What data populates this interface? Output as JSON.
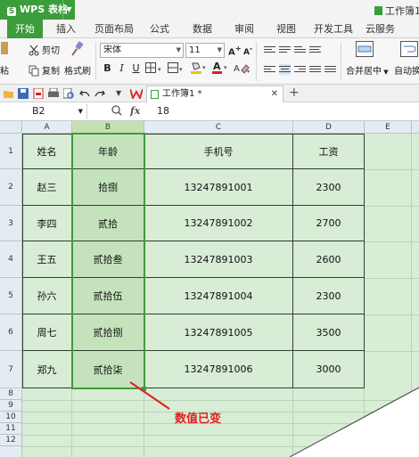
{
  "app": {
    "name": "WPS 表格",
    "document_title": "工作簿1",
    "doc_tab": "工作簿1 *"
  },
  "menu": [
    "开始",
    "插入",
    "页面布局",
    "公式",
    "数据",
    "审阅",
    "视图",
    "开发工具",
    "云服务"
  ],
  "ribbon": {
    "paste_fragment": "粘",
    "cut": "剪切",
    "copy": "复制",
    "format_painter": "格式刷",
    "font_name": "宋体",
    "font_size": "11",
    "bold": "B",
    "italic": "I",
    "underline": "U",
    "merge_center": "合并居中",
    "auto_fragment": "自动换"
  },
  "formula_bar": {
    "name_box": "B2",
    "fx": "fx",
    "value": "18"
  },
  "columns": [
    "A",
    "B",
    "C",
    "D",
    "E"
  ],
  "rows": [
    "1",
    "2",
    "3",
    "4",
    "5",
    "6",
    "7",
    "8",
    "9",
    "10",
    "11",
    "12"
  ],
  "table": {
    "headers": [
      "姓名",
      "年龄",
      "手机号",
      "工资"
    ],
    "rows": [
      [
        "赵三",
        "拾捌",
        "13247891001",
        "2300"
      ],
      [
        "李四",
        "贰拾",
        "13247891002",
        "2700"
      ],
      [
        "王五",
        "贰拾叁",
        "13247891003",
        "2600"
      ],
      [
        "孙六",
        "贰拾伍",
        "13247891004",
        "2300"
      ],
      [
        "周七",
        "贰拾捌",
        "13247891005",
        "3500"
      ],
      [
        "郑九",
        "贰拾柒",
        "13247891006",
        "3000"
      ]
    ]
  },
  "annotation": "数值已变",
  "colors": {
    "accent": "#3b9d3b",
    "sheet_bg": "#d8ecd6",
    "selection": "#c4e3bc",
    "annotation": "#e02020"
  }
}
